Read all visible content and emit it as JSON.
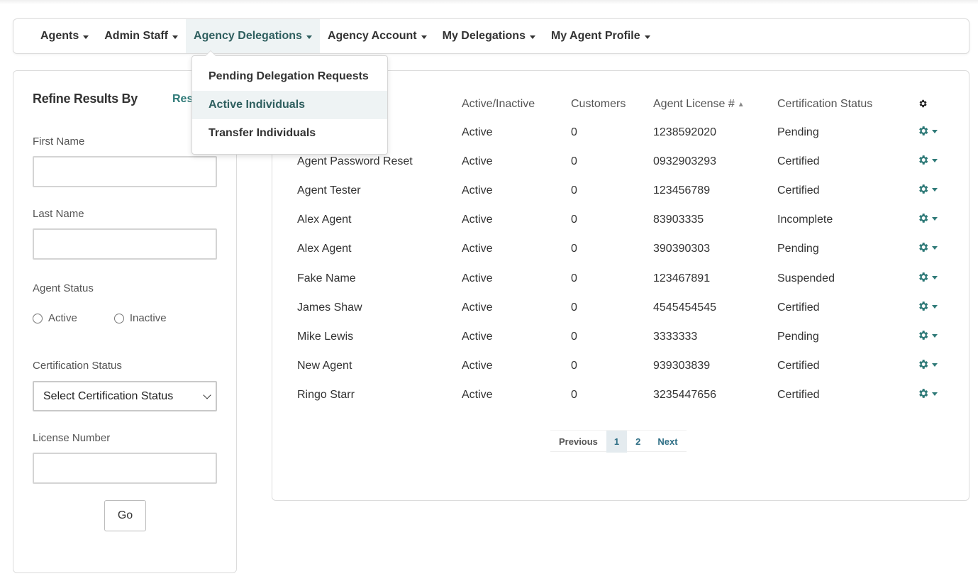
{
  "nav": {
    "items": [
      {
        "label": "Agents"
      },
      {
        "label": "Admin Staff"
      },
      {
        "label": "Agency Delegations"
      },
      {
        "label": "Agency Account"
      },
      {
        "label": "My Delegations"
      },
      {
        "label": "My Agent Profile"
      }
    ],
    "active_index": 2
  },
  "dropdown": {
    "items": [
      {
        "label": "Pending Delegation Requests"
      },
      {
        "label": "Active Individuals"
      },
      {
        "label": "Transfer Individuals"
      }
    ],
    "highlighted_index": 1
  },
  "sidebar": {
    "title": "Refine Results By",
    "reset_label": "Res",
    "first_name": {
      "label": "First Name",
      "value": ""
    },
    "last_name": {
      "label": "Last Name",
      "value": ""
    },
    "agent_status": {
      "label": "Agent Status",
      "options": [
        "Active",
        "Inactive"
      ]
    },
    "certification_status": {
      "label": "Certification Status",
      "selected": "Select Certification Status"
    },
    "license_number": {
      "label": "License Number",
      "value": ""
    },
    "go_label": "Go"
  },
  "table": {
    "headers": {
      "active": "Active/Inactive",
      "customers": "Customers",
      "license": "Agent License #",
      "certification": "Certification Status"
    },
    "rows": [
      {
        "name": "",
        "active": "Active",
        "customers": "0",
        "license": "1238592020",
        "certification": "Pending"
      },
      {
        "name": "Agent Password Reset",
        "active": "Active",
        "customers": "0",
        "license": "0932903293",
        "certification": "Certified"
      },
      {
        "name": "Agent Tester",
        "active": "Active",
        "customers": "0",
        "license": "123456789",
        "certification": "Certified"
      },
      {
        "name": "Alex Agent",
        "active": "Active",
        "customers": "0",
        "license": "83903335",
        "certification": "Incomplete"
      },
      {
        "name": "Alex Agent",
        "active": "Active",
        "customers": "0",
        "license": "390390303",
        "certification": "Pending"
      },
      {
        "name": "Fake Name",
        "active": "Active",
        "customers": "0",
        "license": "123467891",
        "certification": "Suspended"
      },
      {
        "name": "James Shaw",
        "active": "Active",
        "customers": "0",
        "license": "4545454545",
        "certification": "Certified"
      },
      {
        "name": "Mike Lewis",
        "active": "Active",
        "customers": "0",
        "license": "3333333",
        "certification": "Pending"
      },
      {
        "name": "New Agent",
        "active": "Active",
        "customers": "0",
        "license": "939303839",
        "certification": "Certified"
      },
      {
        "name": "Ringo Starr",
        "active": "Active",
        "customers": "0",
        "license": "3235447656",
        "certification": "Certified"
      }
    ]
  },
  "pagination": {
    "previous": "Previous",
    "pages": [
      "1",
      "2"
    ],
    "current": "1",
    "next": "Next"
  },
  "icons": {
    "header_gear": "gear-icon",
    "row_action": "gear-icon"
  },
  "colors": {
    "accent": "#2f7a78",
    "active_nav_bg": "#eef3f4",
    "border": "#dcdcdc"
  }
}
